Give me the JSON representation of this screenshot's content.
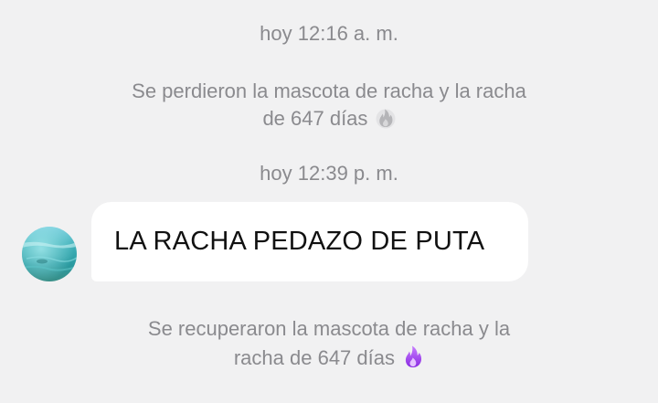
{
  "chat": {
    "timestamp_1": "hoy 12:16 a. m.",
    "lost_message": {
      "line1": "Se perdieron la mascota de racha y la racha",
      "line2": "de 647 días",
      "icon": "flame-icon-gray"
    },
    "timestamp_2": "hoy 12:39 p. m.",
    "incoming_message": {
      "text": "LA RACHA PEDAZO DE PUTA",
      "avatar": "avatar"
    },
    "recovered_message": {
      "line1": "Se recuperaron la mascota de racha y la",
      "line2": "racha de 647 días",
      "icon": "flame-icon-purple"
    }
  },
  "colors": {
    "background": "#f1f1f2",
    "system_text": "#8a8a8e",
    "bubble": "#ffffff",
    "flame_gray": "#b5b5b8",
    "flame_purple": "#a64cf5"
  }
}
